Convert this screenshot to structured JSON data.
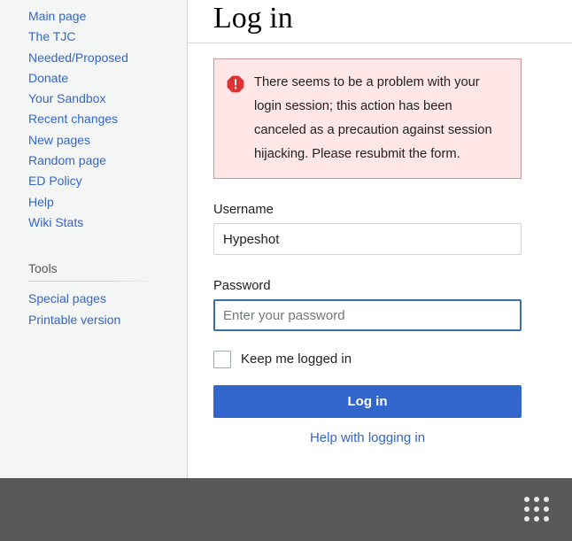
{
  "sidebar": {
    "nav_items": [
      {
        "label": "Main page"
      },
      {
        "label": "The TJC"
      },
      {
        "label": "Needed/Proposed"
      },
      {
        "label": "Donate"
      },
      {
        "label": "Your Sandbox"
      },
      {
        "label": "Recent changes"
      },
      {
        "label": "New pages"
      },
      {
        "label": "Random page"
      },
      {
        "label": "ED Policy"
      },
      {
        "label": "Help"
      },
      {
        "label": "Wiki Stats"
      }
    ],
    "tools_heading": "Tools",
    "tools_items": [
      {
        "label": "Special pages"
      },
      {
        "label": "Printable version"
      }
    ]
  },
  "main": {
    "title": "Log in",
    "error": {
      "icon": "error-octagon-icon",
      "message": "There seems to be a problem with your login session; this action has been canceled as a precaution against session hijacking. Please resubmit the form.",
      "background_color": "#fee7e6",
      "border_color": "#d19595",
      "icon_color": "#d33"
    },
    "form": {
      "username_label": "Username",
      "username_value": "Hypeshot",
      "password_label": "Password",
      "password_value": "",
      "password_placeholder": "Enter your password",
      "password_focused": true,
      "focus_border_color": "#3b6ea8",
      "keep_logged_in_label": "Keep me logged in",
      "keep_logged_in_checked": false,
      "submit_label": "Log in",
      "submit_color": "#3366cc",
      "help_link_label": "Help with logging in",
      "link_color": "#3366cc"
    }
  },
  "bottom_bar": {
    "background_color": "#58585b",
    "grid_icon": "apps-grid-icon",
    "dot_color": "#e8e8e8"
  }
}
